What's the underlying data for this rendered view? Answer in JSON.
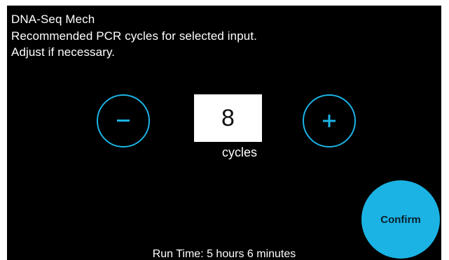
{
  "header": {
    "title": "DNA-Seq Mech",
    "line2": "Recommended PCR cycles for selected input.",
    "line3": "Adjust if necessary."
  },
  "stepper": {
    "decrement_icon": "minus-icon",
    "increment_icon": "plus-icon",
    "value": "8",
    "unit_label": "cycles"
  },
  "confirm": {
    "label": "Confirm"
  },
  "footer": {
    "runtime": "Run Time: 5 hours 6 minutes"
  },
  "colors": {
    "background": "#000000",
    "accent": "#1bb3e4",
    "text": "#ffffff",
    "value_box": "#ffffff"
  }
}
